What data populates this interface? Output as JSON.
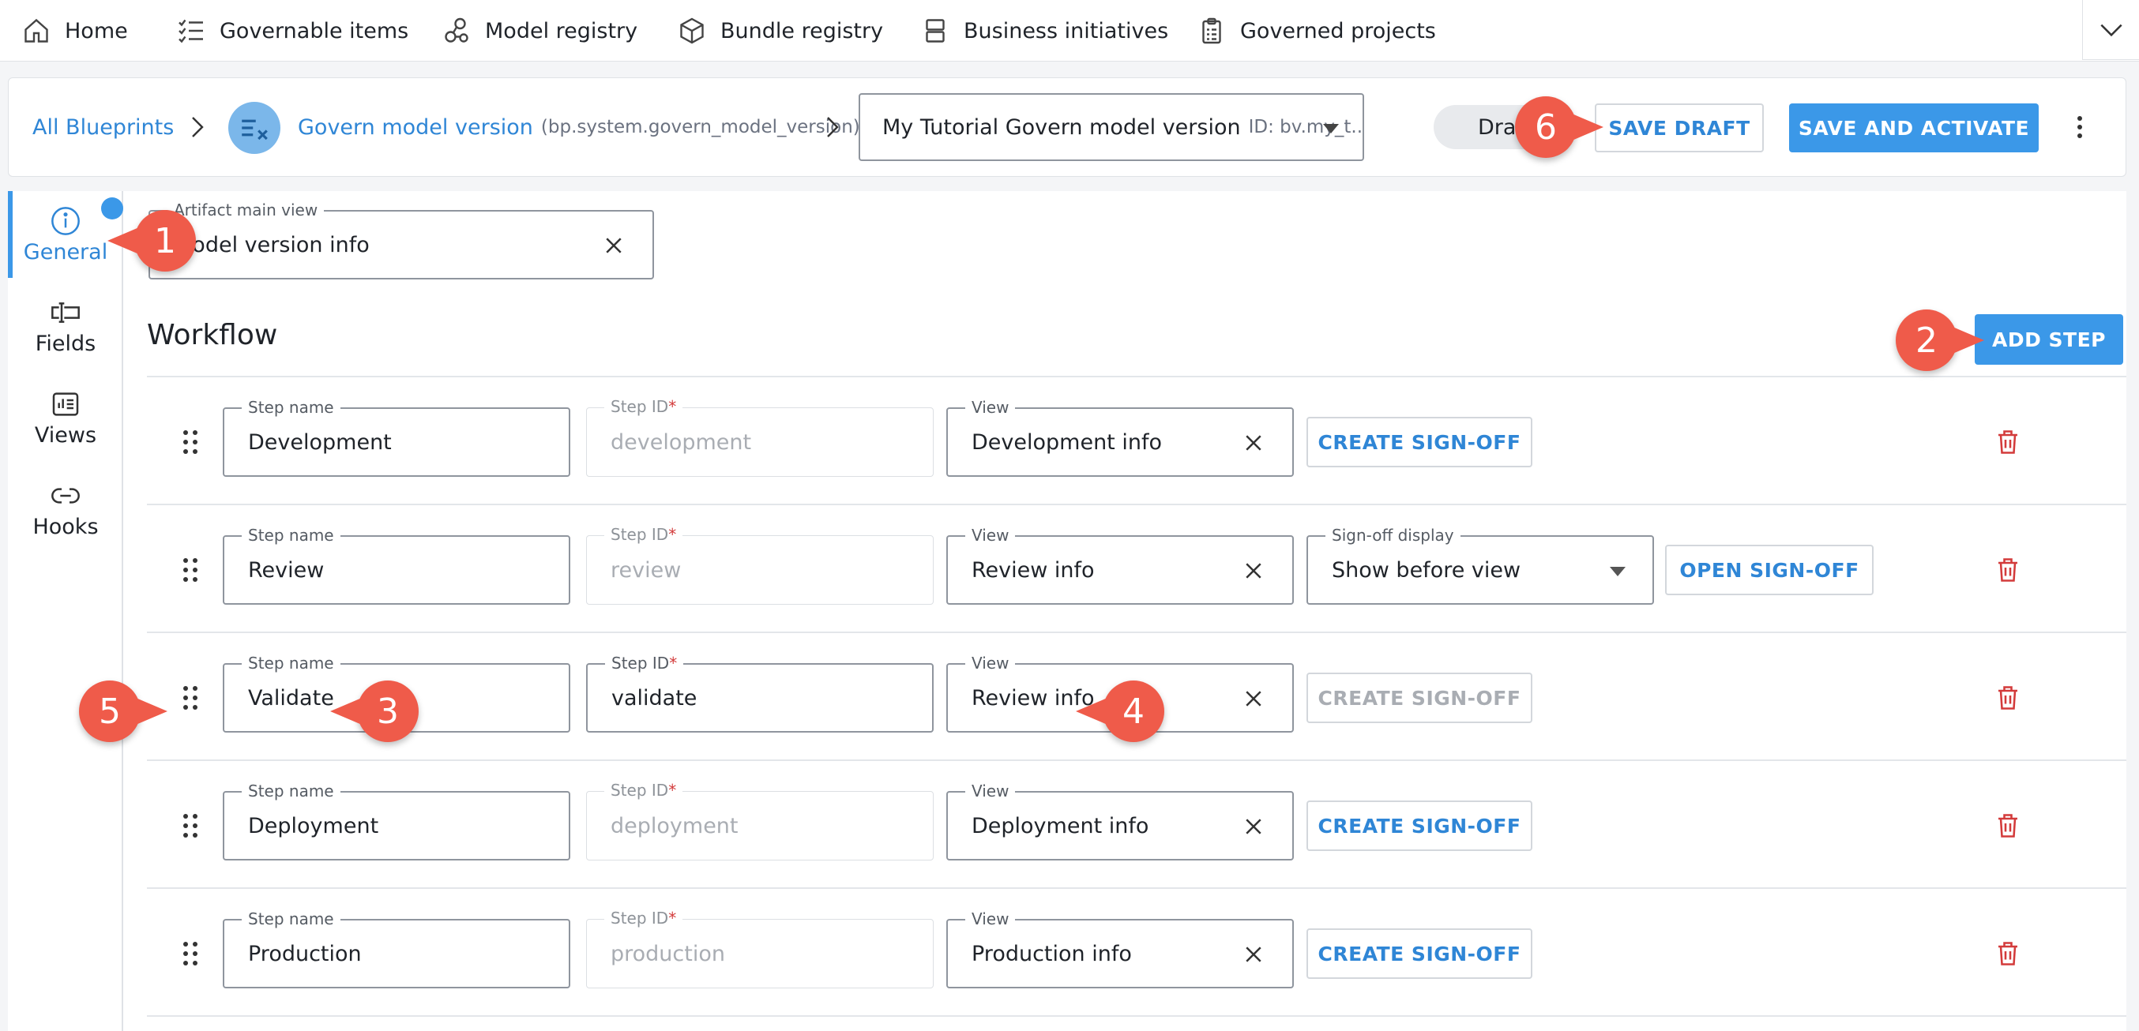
{
  "topnav": {
    "items": [
      {
        "label": "Home",
        "icon": "home-icon"
      },
      {
        "label": "Governable items",
        "icon": "checklist-icon"
      },
      {
        "label": "Model registry",
        "icon": "nodes-icon"
      },
      {
        "label": "Bundle registry",
        "icon": "box-icon"
      },
      {
        "label": "Business initiatives",
        "icon": "stack-icon"
      },
      {
        "label": "Governed projects",
        "icon": "clipboard-icon"
      }
    ],
    "collapse_icon": "chevron-down-icon"
  },
  "header": {
    "all_blueprints": "All Blueprints",
    "blueprint_name": "Govern model version",
    "blueprint_id": "(bp.system.govern_model_version)",
    "version_name": "My Tutorial Govern model version",
    "version_id": "ID: bv.my_t...",
    "status": "Draft",
    "save_draft": "SAVE DRAFT",
    "save_activate": "SAVE AND ACTIVATE"
  },
  "rail": {
    "items": [
      {
        "label": "General",
        "icon": "info-icon"
      },
      {
        "label": "Fields",
        "icon": "text-field-icon"
      },
      {
        "label": "Views",
        "icon": "dashboard-icon"
      },
      {
        "label": "Hooks",
        "icon": "link-icon"
      }
    ]
  },
  "main": {
    "artifact_view_label": "Artifact main view",
    "artifact_view_value": "Model version info",
    "workflow_title": "Workflow",
    "add_step": "ADD STEP",
    "labels": {
      "step_name": "Step name",
      "step_id": "Step ID",
      "view": "View",
      "signoff_display": "Sign-off display",
      "required": "*"
    },
    "steps": [
      {
        "name": "Development",
        "id": "development",
        "view": "Development info",
        "action": "CREATE SIGN-OFF"
      },
      {
        "name": "Review",
        "id": "review",
        "view": "Review info",
        "signoff_display": "Show before view",
        "action": "OPEN SIGN-OFF"
      },
      {
        "name": "Validate",
        "id": "validate",
        "view": "Review info",
        "action": "CREATE SIGN-OFF"
      },
      {
        "name": "Deployment",
        "id": "deployment",
        "view": "Deployment info",
        "action": "CREATE SIGN-OFF"
      },
      {
        "name": "Production",
        "id": "production",
        "view": "Production info",
        "action": "CREATE SIGN-OFF"
      }
    ]
  },
  "callouts": [
    "1",
    "2",
    "3",
    "4",
    "5",
    "6"
  ],
  "colors": {
    "accent": "#3b98e8",
    "link": "#2f86d6",
    "callout": "#ef5b4a",
    "danger": "#d33b3b"
  }
}
